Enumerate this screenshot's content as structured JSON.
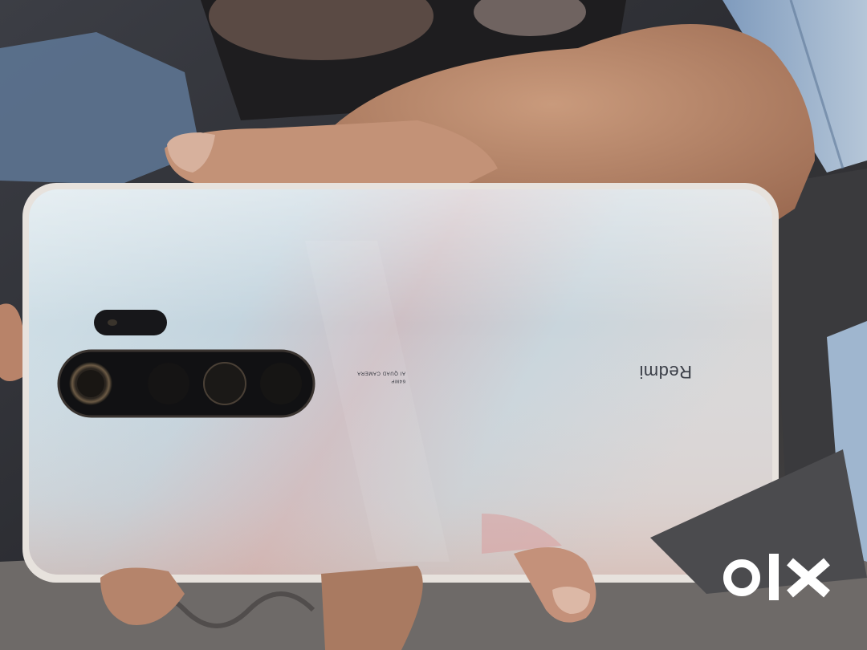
{
  "phone": {
    "brand": "Redmi",
    "camera_line1": "64MP",
    "camera_line2": "AI QUAD CAMERA"
  },
  "watermark": {
    "logo_text": "olx"
  },
  "colors": {
    "phone_body": "#c7d6de",
    "phone_frame": "#e6e1dc",
    "camera_module": "#141416",
    "background_dark": "#2a2a2c",
    "skin": "#bd8d70",
    "shirt": "#8ea6c2"
  }
}
